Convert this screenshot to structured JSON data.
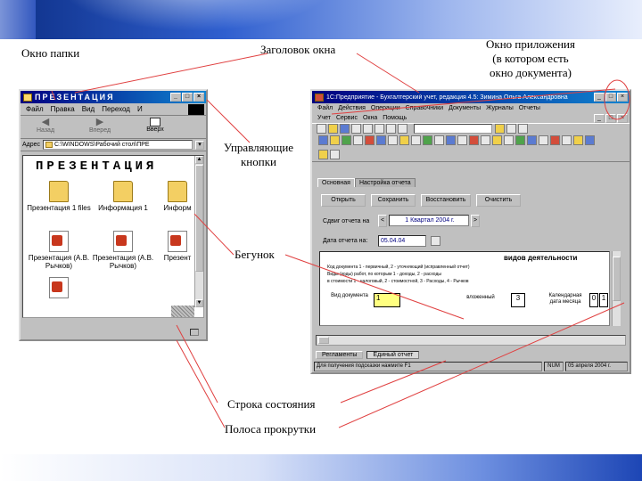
{
  "slide": {
    "callouts": {
      "folder_window": "Окно папки",
      "window_title": "Заголовок окна",
      "app_window": [
        "Окно приложения",
        "(в котором есть",
        "окно документа)"
      ],
      "control_buttons": [
        "Управляющие",
        "кнопки"
      ],
      "slider": "Бегунок",
      "status_bar": "Строка состояния",
      "scrollbar": "Полоса прокрутки"
    }
  },
  "folder_window": {
    "title": "ПРЕЗЕНТАЦИЯ",
    "menu": [
      "Файл",
      "Правка",
      "Вид",
      "Переход",
      "И"
    ],
    "toolbar": [
      "Назад",
      "Вперед",
      "Вверх"
    ],
    "address_label": "Адрес",
    "address_value": "C:\\WINDOWS\\Рабочий стол\\ПРЕ",
    "banner": "ПРЕЗЕНТАЦИЯ",
    "items": [
      {
        "name": "Презентация 1 files",
        "icon": "folder-icon"
      },
      {
        "name": "Информация 1",
        "icon": "folder-icon"
      },
      {
        "name": "Информ",
        "icon": "folder-icon"
      },
      {
        "name": "Презентация (А.В. Рычков)",
        "icon": "ppt-file-icon"
      },
      {
        "name": "Презентация (А.В. Рычков)",
        "icon": "ppt-file-icon"
      },
      {
        "name": "Презент",
        "icon": "ppt-file-icon"
      },
      {
        "name": "",
        "icon": "ppt-file-icon"
      }
    ]
  },
  "app_window": {
    "title": "1С:Предприятие - Бухгалтерский учет, редакция 4.5: Зимина Ольга Александровна",
    "menu1": [
      "Файл",
      "Действия",
      "Операции",
      "Справочники",
      "Документы",
      "Журналы",
      "Отчеты"
    ],
    "menu2": [
      "Учет",
      "Сервис",
      "Окна",
      "Помощь"
    ],
    "tabs": [
      "Основная",
      "Настройка отчета"
    ],
    "buttons": [
      "Открыть",
      "Сохранить",
      "Восстановить",
      "Очистить"
    ],
    "period_label": "Сдвиг отчета на",
    "period_value": "1 Квартал 2004 г.",
    "date_label": "Дата отчета на:",
    "date_value": "05.04.04",
    "report_header": "видов деятельности",
    "report_lines": [
      "Код документа 1 - первичный, 2 - уточняющий (исправленный отчет)",
      "Виды (коды) работ, по которым 1 - доходы, 2 - расходы",
      "в стоимости 1 - налоговый, 2 - стоимостной, 3 - Расходы, 4 - Рычков"
    ],
    "report_cells": [
      "Вид документа",
      "1",
      "вложенный",
      "3",
      "Календарная дата месяца",
      "0",
      "1"
    ],
    "taskbar": [
      "Регламенты",
      "Единый отчет"
    ],
    "status_text": "Для получения подсказки нажмите F1",
    "status_indicator": "NUM",
    "status_date": "05 апреля 2004 г."
  }
}
